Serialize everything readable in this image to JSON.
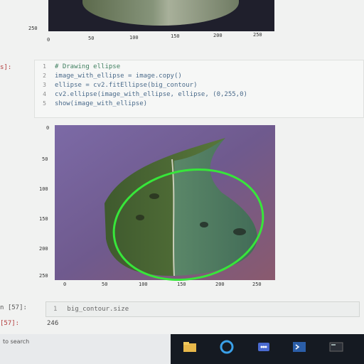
{
  "top_figure": {
    "y_tick": "250",
    "x_ticks": [
      "0",
      "50",
      "100",
      "150",
      "200",
      "250"
    ]
  },
  "code_cell": {
    "prompt": "s]:",
    "line_numbers": [
      "1",
      "2",
      "3",
      "4",
      "5"
    ],
    "lines": [
      "# Drawing ellipse",
      "image_with_ellipse = image.copy()",
      "ellipse = cv2.fitEllipse(big_contour)",
      "cv2.ellipse(image_with_ellipse, ellipse, (0,255,0)",
      "show(image_with_ellipse)"
    ]
  },
  "output_figure": {
    "y_ticks": [
      "0",
      "50",
      "100",
      "150",
      "200",
      "250"
    ],
    "x_ticks": [
      "0",
      "50",
      "100",
      "150",
      "200",
      "250"
    ],
    "ellipse_color": "#37e63a"
  },
  "lower_cell": {
    "in_prompt": "n [57]:",
    "line_number": "1",
    "input_text": "big_contour.size",
    "out_prompt": "[57]:",
    "out_value": "246"
  },
  "taskbar": {
    "search_text": "to search",
    "icons": [
      "file-explorer-icon",
      "edge-icon",
      "teams-icon",
      "powershell-icon",
      "terminal-icon"
    ]
  }
}
